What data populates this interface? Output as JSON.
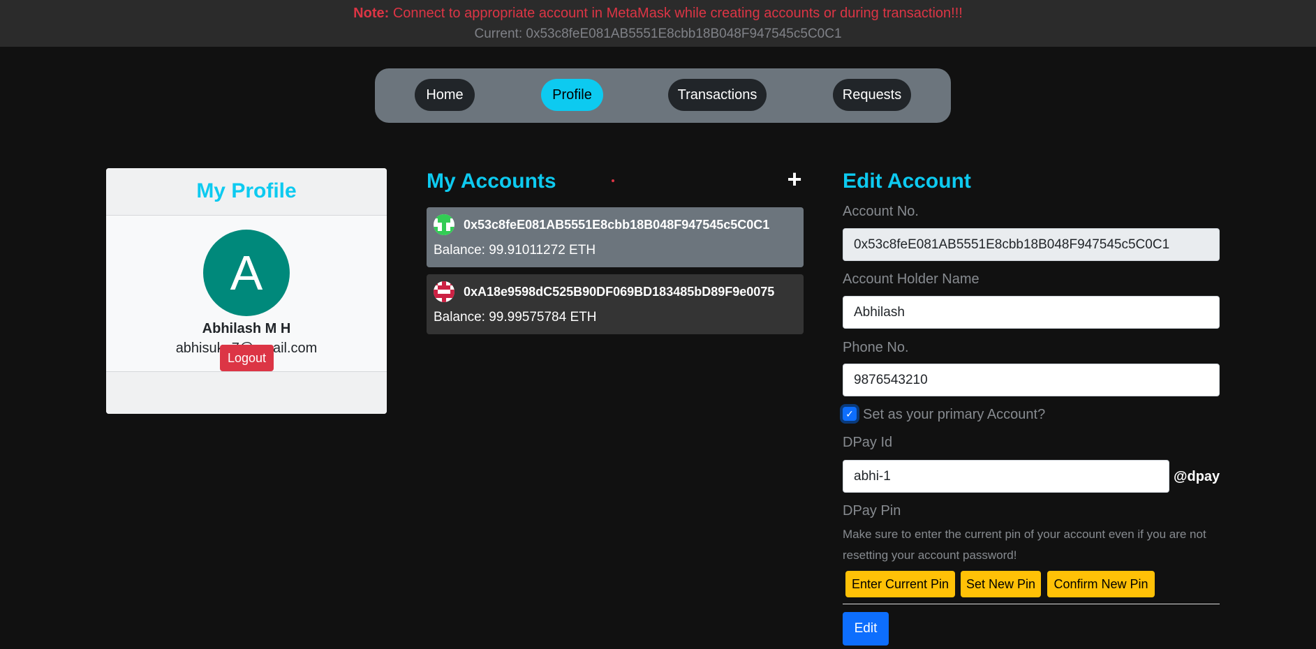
{
  "banner": {
    "note_label": "Note:",
    "note_text": " Connect to appropriate account in MetaMask while creating accounts or during transaction!!!",
    "current_label": "Current: ",
    "current_address": "0x53c8feE081AB5551E8cbb18B048F947545c5C0C1"
  },
  "nav": {
    "items": [
      {
        "label": "Home",
        "active": false
      },
      {
        "label": "Profile",
        "active": true
      },
      {
        "label": "Transactions",
        "active": false
      },
      {
        "label": "Requests",
        "active": false
      }
    ]
  },
  "profile": {
    "title": "My Profile",
    "avatar_letter": "A",
    "name": "Abhilash M H",
    "email": "abhisuku7@gmail.com",
    "logout_label": "Logout"
  },
  "accounts": {
    "title": "My Accounts",
    "add_icon": "plus-icon",
    "list": [
      {
        "address": "0x53c8feE081AB5551E8cbb18B048F947545c5C0C1",
        "balance": "Balance: 99.91011272 ETH",
        "icon": "identicon-green",
        "selected": true
      },
      {
        "address": "0xA18e9598dC525B90DF069BD183485bD89F9e0075",
        "balance": "Balance: 99.99575784 ETH",
        "icon": "identicon-red",
        "selected": false
      }
    ]
  },
  "edit": {
    "title": "Edit Account",
    "account_no_label": "Account No.",
    "account_no_value": "0x53c8feE081AB5551E8cbb18B048F947545c5C0C1",
    "holder_label": "Account Holder Name",
    "holder_value": "Abhilash",
    "phone_label": "Phone No.",
    "phone_value": "9876543210",
    "primary_label": "Set as your primary Account?",
    "primary_checked": true,
    "dpay_id_label": "DPay Id",
    "dpay_id_value": "abhi-1",
    "dpay_suffix": "@dpay",
    "pin_label": "DPay Pin",
    "pin_help": "Make sure to enter the current pin of your account even if you are not resetting your account password!",
    "current_pin_label": "Enter Current Pin",
    "new_pin_label": "Set New Pin",
    "confirm_pin_label": "Confirm New Pin",
    "submit_label": "Edit"
  },
  "colors": {
    "accent": "#0dcaf0",
    "danger": "#dc3545",
    "warning": "#ffc107",
    "primary": "#0d6efd",
    "background": "#111111"
  }
}
